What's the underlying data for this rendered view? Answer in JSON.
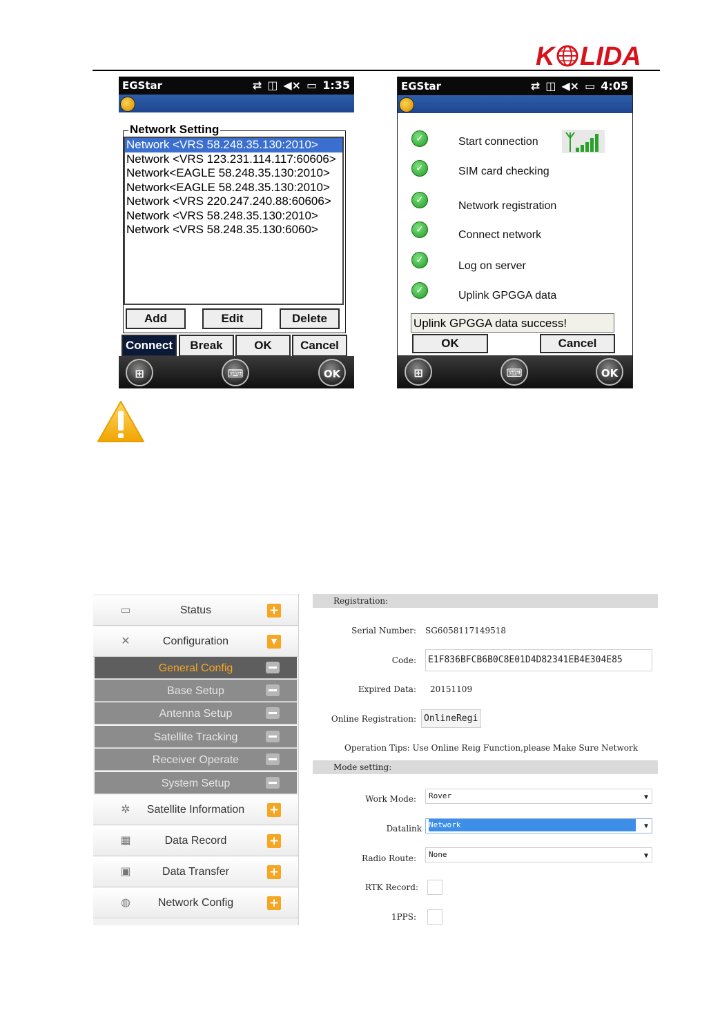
{
  "header": {
    "brand": "KOLIDA"
  },
  "left_phone": {
    "app_title": "EGStar",
    "time": "1:35",
    "groupbox_title": "Network Setting",
    "networks": [
      "Network <VRS  58.248.35.130:2010>",
      "Network <VRS  123.231.114.117:60606>",
      "Network<EAGLE 58.248.35.130:2010>",
      "Network<EAGLE 58.248.35.130:2010>",
      "Network <VRS  220.247.240.88:60606>",
      "Network <VRS  58.248.35.130:2010>",
      "Network <VRS  58.248.35.130:6060>"
    ],
    "selected_index": 0,
    "add_label": "Add",
    "edit_label": "Edit",
    "delete_label": "Delete",
    "connect_label": "Connect",
    "break_label": "Break",
    "ok_label": "OK",
    "cancel_label": "Cancel",
    "taskbar_ok": "OK"
  },
  "right_phone": {
    "app_title": "EGStar",
    "time": "4:05",
    "steps": [
      "Start connection",
      "SIM card checking",
      "Network registration",
      "Connect network",
      "Log on server",
      "Uplink GPGGA data"
    ],
    "status_message": "Uplink GPGGA data success!",
    "ok_label": "OK",
    "cancel_label": "Cancel",
    "taskbar_ok": "OK"
  },
  "web": {
    "sidebar": {
      "status": "Status",
      "configuration": "Configuration",
      "sub_items": [
        "General Config",
        "Base Setup",
        "Antenna Setup",
        "Satellite Tracking",
        "Receiver Operate",
        "System Setup"
      ],
      "active_sub": 0,
      "satellite_information": "Satellite Information",
      "data_record": "Data Record",
      "data_transfer": "Data Transfer",
      "network_config": "Network Config"
    },
    "registration": {
      "section_title": "Registration:",
      "serial_label": "Serial Number:",
      "serial_value": "SG6058117149518",
      "code_label": "Code:",
      "code_value": "E1F836BFCB6B0C8E01D4D82341EB4E304E85",
      "expired_label": "Expired Data:",
      "expired_value": "20151109",
      "online_label": "Online Registration:",
      "online_button": "OnlineRegi",
      "tips_text": "Operation Tips: Use Online Reig Function,please Make Sure Network"
    },
    "mode": {
      "section_title": "Mode setting:",
      "work_mode_label": "Work Mode:",
      "work_mode_value": "Rover",
      "datalink_label": "Datalink",
      "datalink_value": "Network",
      "radio_route_label": "Radio Route:",
      "radio_route_value": "None",
      "rtk_record_label": "RTK Record:",
      "pps_label": "1PPS:"
    }
  }
}
